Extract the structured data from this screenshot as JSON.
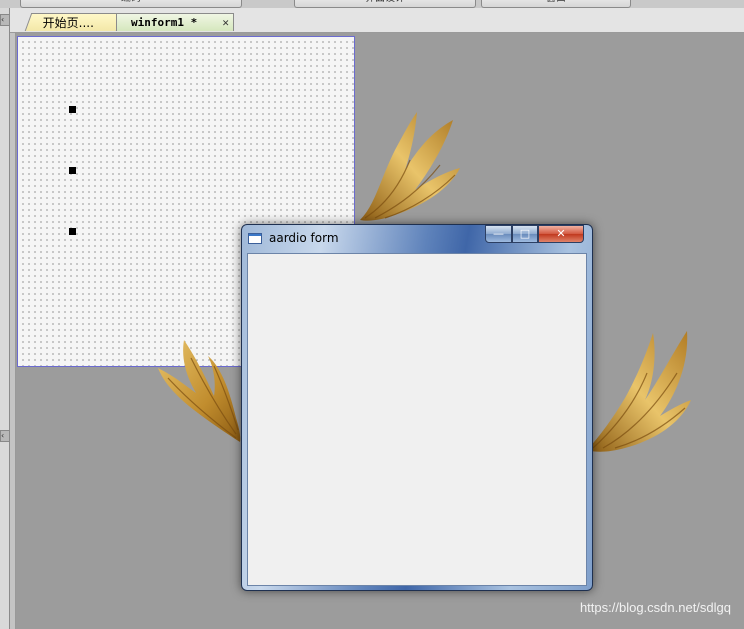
{
  "menu": {
    "items": [
      "编码",
      "界面设计",
      "窗口"
    ]
  },
  "tabs": [
    {
      "label": "开始页...."
    },
    {
      "label": "winform1 *",
      "close": "✕"
    }
  ],
  "form_window": {
    "title": "aardio form",
    "minimize": "—",
    "maximize": "□",
    "close": "✕"
  },
  "watermark": "https://blog.csdn.net/sdlgq",
  "colors": {
    "workspace": "#9c9c9c",
    "design_border": "#6b6bd0",
    "wing_gold": "#c99a35"
  }
}
